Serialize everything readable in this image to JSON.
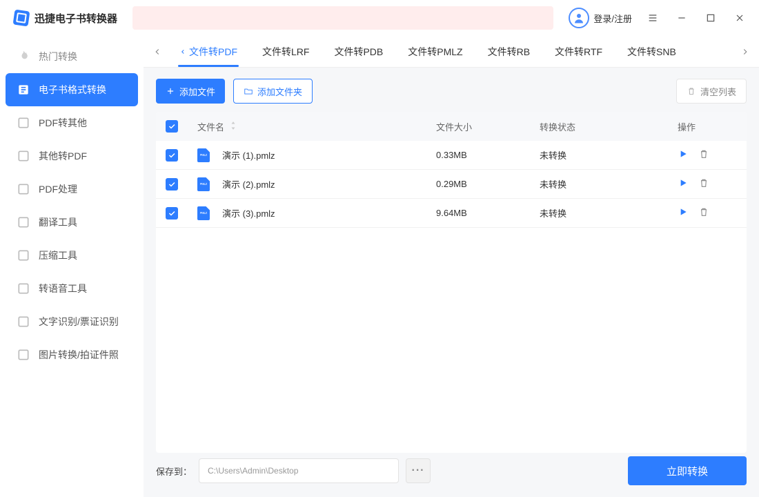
{
  "app_title": "迅捷电子书转换器",
  "login_label": "登录/注册",
  "sidebar": {
    "items": [
      {
        "label": "热门转换"
      },
      {
        "label": "电子书格式转换"
      },
      {
        "label": "PDF转其他"
      },
      {
        "label": "其他转PDF"
      },
      {
        "label": "PDF处理"
      },
      {
        "label": "翻译工具"
      },
      {
        "label": "压缩工具"
      },
      {
        "label": "转语音工具"
      },
      {
        "label": "文字识别/票证识别"
      },
      {
        "label": "图片转换/拍证件照"
      }
    ]
  },
  "tabs": [
    {
      "label": "文件转PDF"
    },
    {
      "label": "文件转LRF"
    },
    {
      "label": "文件转PDB"
    },
    {
      "label": "文件转PMLZ"
    },
    {
      "label": "文件转RB"
    },
    {
      "label": "文件转RTF"
    },
    {
      "label": "文件转SNB"
    }
  ],
  "toolbar": {
    "add_file": "添加文件",
    "add_folder": "添加文件夹",
    "clear_list": "清空列表"
  },
  "table": {
    "headers": {
      "name": "文件名",
      "size": "文件大小",
      "status": "转换状态",
      "ops": "操作"
    },
    "rows": [
      {
        "name": "演示 (1).pmlz",
        "size": "0.33MB",
        "status": "未转换"
      },
      {
        "name": "演示 (2).pmlz",
        "size": "0.29MB",
        "status": "未转换"
      },
      {
        "name": "演示 (3).pmlz",
        "size": "9.64MB",
        "status": "未转换"
      }
    ]
  },
  "footer": {
    "save_to_label": "保存到：",
    "path": "C:\\Users\\Admin\\Desktop",
    "convert_label": "立即转换"
  }
}
